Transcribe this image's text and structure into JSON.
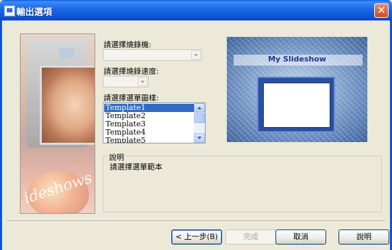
{
  "window": {
    "title": "輸出選項",
    "close_glyph": "✕"
  },
  "side_image": {
    "overlay_text": "ideshows M"
  },
  "form": {
    "burner_label": "請選擇燒錄機:",
    "burner_value": "",
    "speed_label": "請選擇燒錄速度:",
    "speed_value": "",
    "template_label": "請選擇選單圖樣:",
    "templates": [
      "Template1",
      "Template2",
      "Template3",
      "Template4",
      "Template5"
    ],
    "selected_template": "Template1"
  },
  "preview": {
    "title": "My Slideshow"
  },
  "description": {
    "legend": "說明",
    "text": "請選擇選單範本"
  },
  "buttons": {
    "back": "< 上一步(B)",
    "finish": "完成",
    "cancel": "取消",
    "help": "說明"
  },
  "colors": {
    "titlebar": "#0b52d8",
    "selection": "#316ac5",
    "dialog_bg": "#ece9d8"
  }
}
